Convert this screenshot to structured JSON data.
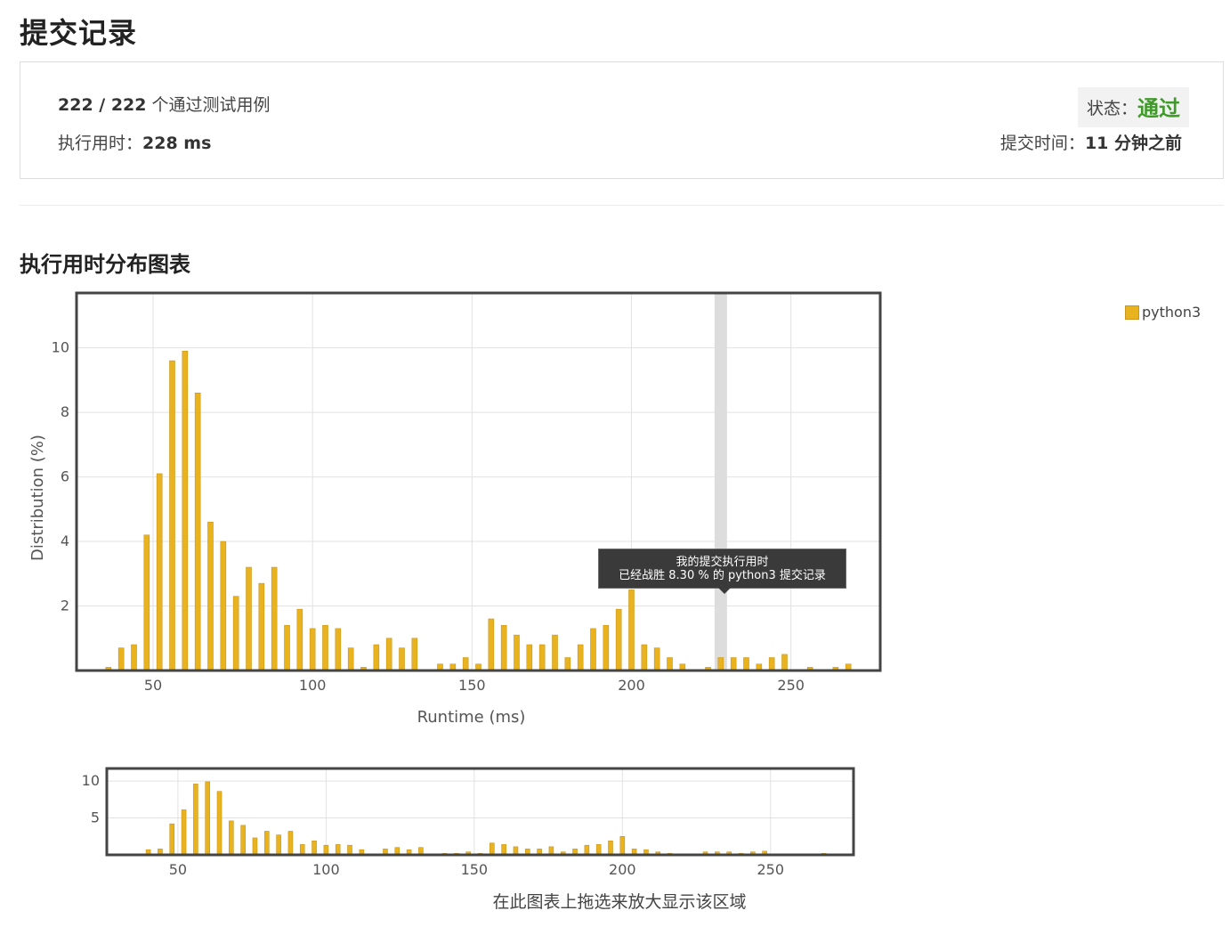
{
  "page": {
    "title": "提交记录",
    "section_title": "执行用时分布图表"
  },
  "summary": {
    "cases_value": "222 / 222",
    "cases_label": " 个通过测试用例",
    "runtime_label": "执行用时：",
    "runtime_value": "228 ms",
    "status_label": "状态：",
    "status_value": "通过",
    "submitted_label": "提交时间：",
    "submitted_value": "11 分钟之前"
  },
  "colors": {
    "bar": "#e9b320",
    "bar_edge": "#c9951a",
    "status_ok": "#3f9a2a",
    "highlight": "#dddddd"
  },
  "tooltip": {
    "line1": "我的提交执行用时",
    "line2": "已经战胜 8.30 % 的 python3 提交记录"
  },
  "legend": {
    "label": "python3"
  },
  "nav_hint": "在此图表上拖选来放大显示该区域",
  "chart_data": {
    "type": "bar",
    "xlabel": "Runtime (ms)",
    "ylabel": "Distribution (%)",
    "xlim": [
      26,
      278
    ],
    "ylim": [
      0,
      11.7
    ],
    "xticks": [
      50,
      100,
      150,
      200,
      250
    ],
    "yticks": [
      2,
      4,
      6,
      8,
      10
    ],
    "nav_yticks": [
      5,
      10
    ],
    "highlight_x": 228,
    "grid": true,
    "legend_position": "top-right",
    "series": [
      {
        "name": "python3",
        "x": [
          36,
          40,
          44,
          48,
          52,
          56,
          60,
          64,
          68,
          72,
          76,
          80,
          84,
          88,
          92,
          96,
          100,
          104,
          108,
          112,
          116,
          120,
          124,
          128,
          132,
          140,
          144,
          148,
          152,
          156,
          160,
          164,
          168,
          172,
          176,
          180,
          184,
          188,
          192,
          196,
          200,
          204,
          208,
          212,
          216,
          224,
          228,
          232,
          236,
          240,
          244,
          248,
          256,
          264,
          268
        ],
        "values": [
          0.1,
          0.7,
          0.8,
          4.2,
          6.1,
          9.6,
          9.9,
          8.6,
          4.6,
          4.0,
          2.3,
          3.2,
          2.7,
          3.2,
          1.4,
          1.9,
          1.3,
          1.4,
          1.3,
          0.7,
          0.1,
          0.8,
          1.0,
          0.7,
          1.0,
          0.2,
          0.2,
          0.4,
          0.2,
          1.6,
          1.4,
          1.1,
          0.8,
          0.8,
          1.1,
          0.4,
          0.8,
          1.3,
          1.4,
          1.9,
          2.5,
          0.8,
          0.7,
          0.4,
          0.2,
          0.1,
          0.4,
          0.4,
          0.4,
          0.2,
          0.4,
          0.5,
          0.1,
          0.1,
          0.2
        ]
      }
    ]
  }
}
